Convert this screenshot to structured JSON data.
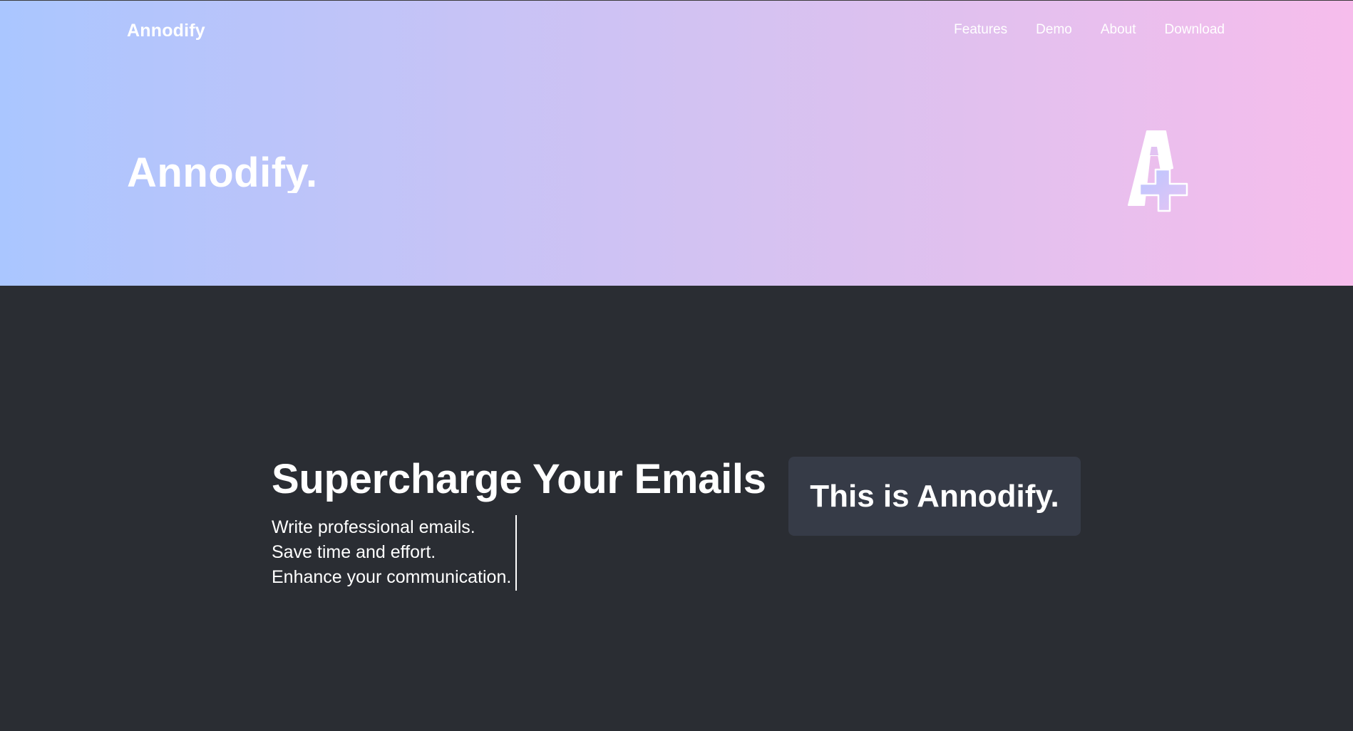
{
  "brand": {
    "name": "Annodify"
  },
  "nav": {
    "items": [
      {
        "label": "Features"
      },
      {
        "label": "Demo"
      },
      {
        "label": "About"
      },
      {
        "label": "Download"
      }
    ]
  },
  "hero": {
    "title": "Annodify.",
    "logo_letter": "A"
  },
  "main": {
    "headline": "Supercharge Your Emails",
    "lines": [
      "Write professional emails.",
      "Save time and effort.",
      "Enhance your communication."
    ],
    "card_text": "This is Annodify."
  },
  "colors": {
    "gradient_start": "#aac6ff",
    "gradient_end": "#f6bdec",
    "dark_bg": "#2a2d33",
    "card_bg": "#363b47",
    "text": "#ffffff"
  },
  "icons": {
    "logo": "annodify-logo-icon"
  }
}
